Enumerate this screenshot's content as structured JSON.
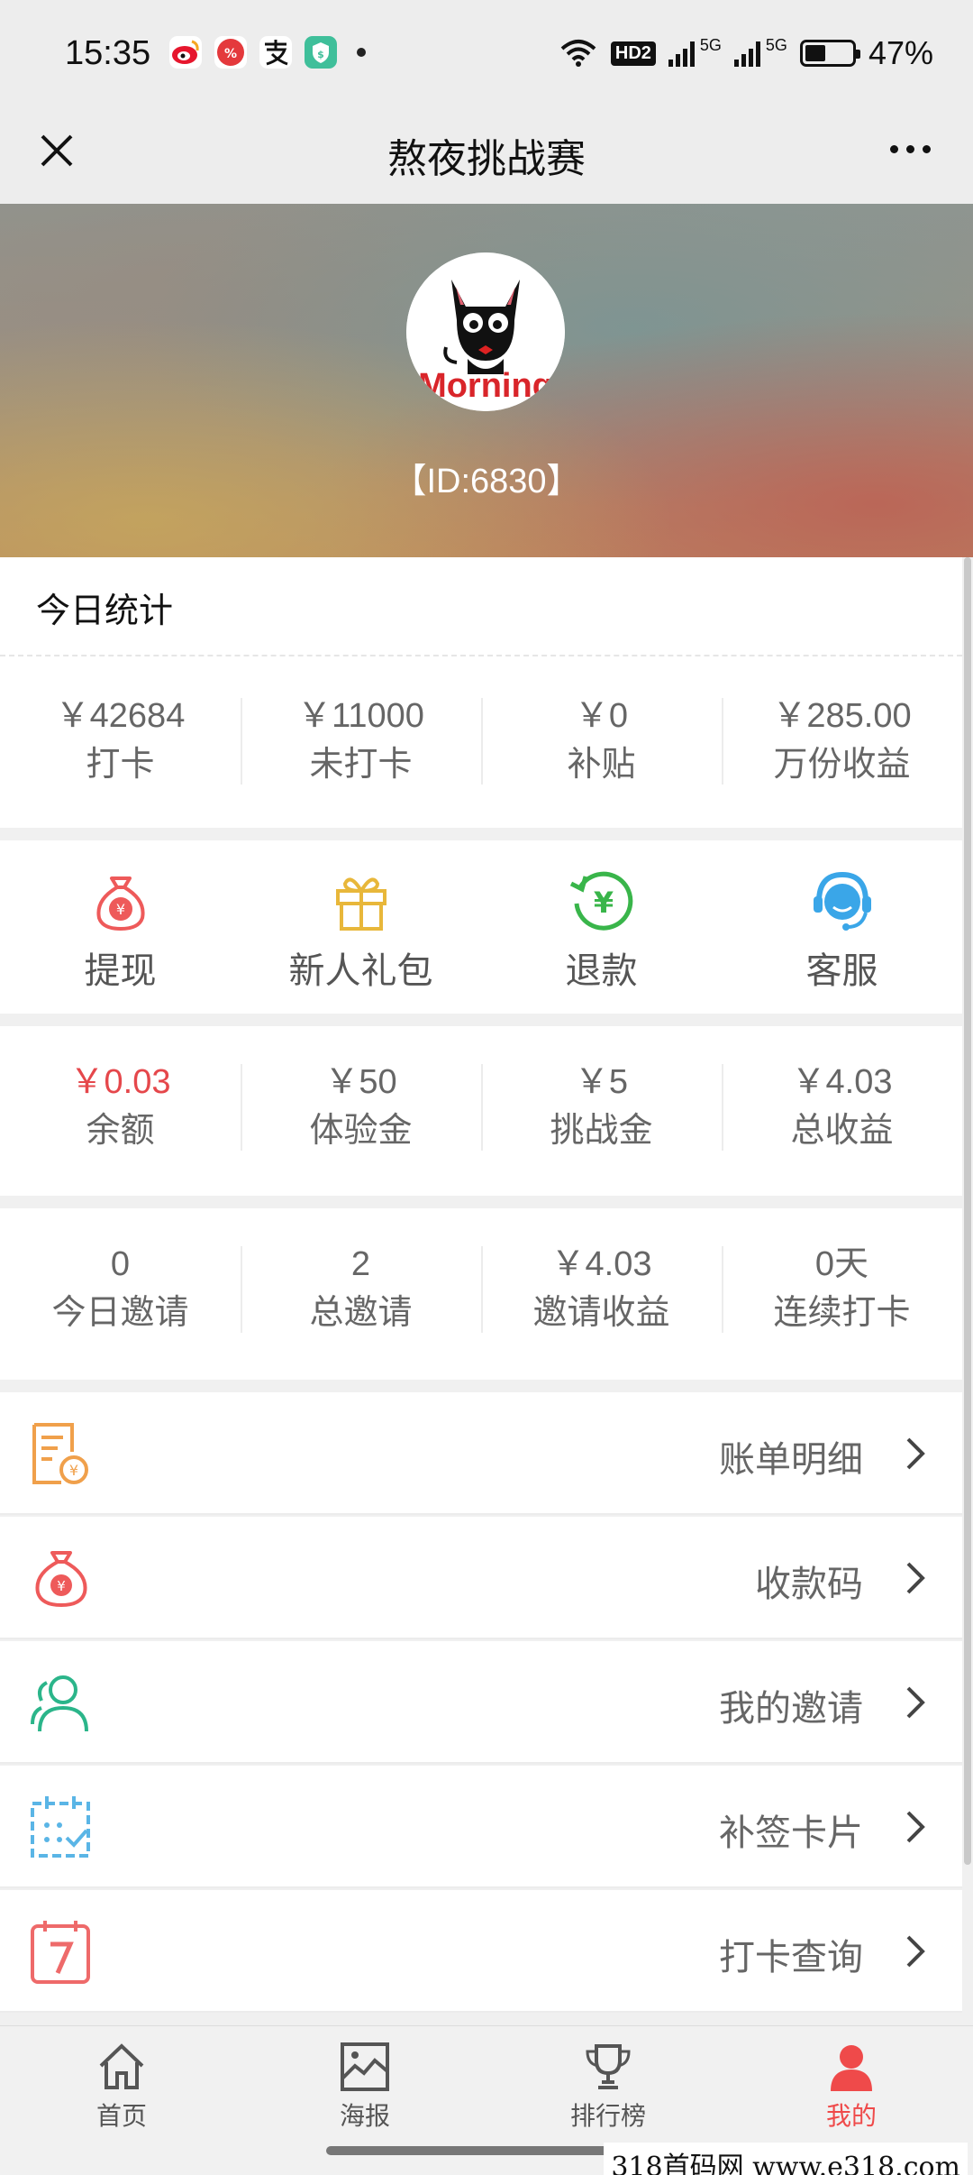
{
  "status_bar": {
    "time": "15:35",
    "app_icons": [
      "weibo-icon",
      "shopping-app-icon",
      "alipay-icon",
      "security-app-icon"
    ],
    "network": "5G",
    "hd_label": "HD2",
    "battery": "47%"
  },
  "nav": {
    "title": "熬夜挑战赛"
  },
  "profile": {
    "avatar_text": "Morning",
    "id_text": "【ID:6830】"
  },
  "today_stats": {
    "title": "今日统计",
    "items": [
      {
        "value": "￥42684",
        "label": "打卡"
      },
      {
        "value": "￥11000",
        "label": "未打卡"
      },
      {
        "value": "￥0",
        "label": "补贴"
      },
      {
        "value": "￥285.00",
        "label": "万份收益"
      }
    ]
  },
  "actions": [
    {
      "label": "提现",
      "icon": "money-bag-icon",
      "color": "#ee5a5a"
    },
    {
      "label": "新人礼包",
      "icon": "gift-icon",
      "color": "#e8b73a"
    },
    {
      "label": "退款",
      "icon": "refund-icon",
      "color": "#39b54a"
    },
    {
      "label": "客服",
      "icon": "customer-service-icon",
      "color": "#3aa6e8"
    }
  ],
  "balances": [
    {
      "value": "￥0.03",
      "label": "余额"
    },
    {
      "value": "￥50",
      "label": "体验金"
    },
    {
      "value": "￥5",
      "label": "挑战金"
    },
    {
      "value": "￥4.03",
      "label": "总收益"
    }
  ],
  "invites": [
    {
      "value": "0",
      "label": "今日邀请"
    },
    {
      "value": "2",
      "label": "总邀请"
    },
    {
      "value": "￥4.03",
      "label": "邀请收益"
    },
    {
      "value": "0天",
      "label": "连续打卡"
    }
  ],
  "menu": [
    {
      "label": "账单明细",
      "icon": "bill-icon"
    },
    {
      "label": "收款码",
      "icon": "money-bag-icon"
    },
    {
      "label": "我的邀请",
      "icon": "users-icon"
    },
    {
      "label": "补签卡片",
      "icon": "calendar-check-icon"
    },
    {
      "label": "打卡查询",
      "icon": "calendar-7-icon"
    }
  ],
  "tabs": [
    {
      "label": "首页",
      "icon": "home-icon"
    },
    {
      "label": "海报",
      "icon": "image-icon"
    },
    {
      "label": "排行榜",
      "icon": "trophy-icon"
    },
    {
      "label": "我的",
      "icon": "user-icon",
      "active": true
    }
  ],
  "watermark": "318首码网  www.e318.com",
  "colors": {
    "accent_red": "#e5474b",
    "tab_active": "#ef4a4a"
  }
}
